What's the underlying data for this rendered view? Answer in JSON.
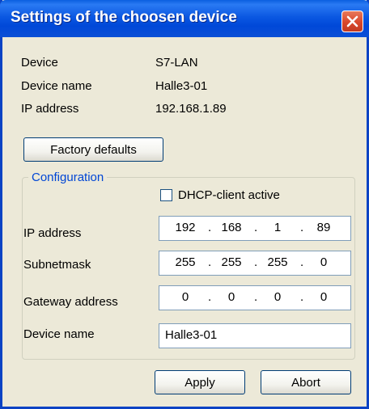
{
  "window": {
    "title": "Settings of the choosen device",
    "close_icon": "close-icon"
  },
  "info": [
    {
      "label": "Device",
      "value": "S7-LAN"
    },
    {
      "label": "Device name",
      "value": "Halle3-01"
    },
    {
      "label": "IP address",
      "value": "192.168.1.89"
    }
  ],
  "factory_button": "Factory defaults",
  "configuration": {
    "legend": "Configuration",
    "dhcp_label": "DHCP-client active",
    "dhcp_checked": false,
    "fields": {
      "ip": {
        "label": "IP address",
        "octets": [
          "192",
          "168",
          "1",
          "89"
        ]
      },
      "subnet": {
        "label": "Subnetmask",
        "octets": [
          "255",
          "255",
          "255",
          "0"
        ]
      },
      "gateway": {
        "label": "Gateway address",
        "octets": [
          "0",
          "0",
          "0",
          "0"
        ]
      },
      "device_name": {
        "label": "Device name",
        "value": "Halle3-01"
      }
    }
  },
  "buttons": {
    "apply": "Apply",
    "abort": "Abort"
  },
  "colors": {
    "title_bar": "#0b58e2",
    "legend_text": "#0046d5",
    "close_button": "#d9472b",
    "dialog_bg": "#ece9d8"
  }
}
